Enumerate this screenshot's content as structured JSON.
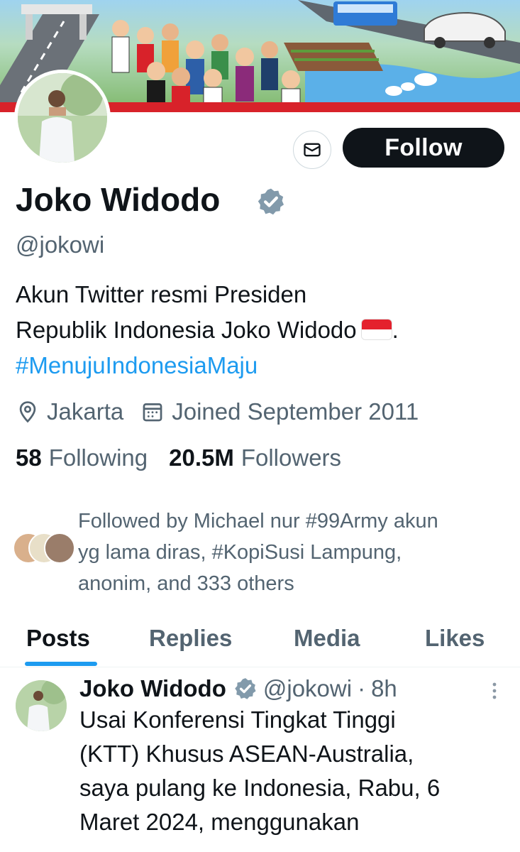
{
  "profile": {
    "display_name": "Joko Widodo",
    "handle": "@jokowi",
    "bio_line1": "Akun Twitter resmi Presiden",
    "bio_line2": "Republik Indonesia Joko Widodo",
    "bio_line2_end": ".",
    "bio_hashtag": "#MenujuIndonesiaMaju",
    "location": "Jakarta",
    "joined": "Joined September 2011",
    "following_count": "58",
    "following_label": "Following",
    "followers_count": "20.5M",
    "followers_label": "Followers"
  },
  "actions": {
    "follow_label": "Follow"
  },
  "followed_by": {
    "line1": "Followed by Michael nur #99Army akun",
    "line2": "yg lama diras, #KopiSusi Lampung,",
    "line3": "anonim, and 333 others"
  },
  "tabs": [
    {
      "label": "Posts",
      "active": true
    },
    {
      "label": "Replies",
      "active": false
    },
    {
      "label": "Media",
      "active": false
    },
    {
      "label": "Likes",
      "active": false
    }
  ],
  "post": {
    "author": "Joko Widodo",
    "handle": "@jokowi",
    "separator": "·",
    "time": "8h",
    "lines": [
      "Usai Konferensi Tingkat Tinggi",
      "(KTT) Khusus ASEAN-Australia,",
      "saya pulang ke Indonesia, Rabu, 6",
      "Maret 2024, menggunakan"
    ]
  },
  "icons": {
    "verified": "verified-badge-icon",
    "mail": "mail-icon",
    "location": "location-pin-icon",
    "calendar": "calendar-icon",
    "more": "more-vertical-icon",
    "flag": "indonesia-flag-icon"
  },
  "colors": {
    "accent": "#1d9bf0",
    "text_primary": "#0f1419",
    "text_secondary": "#536471",
    "verified_gray": "#829aab",
    "follow_bg": "#0f1419"
  }
}
